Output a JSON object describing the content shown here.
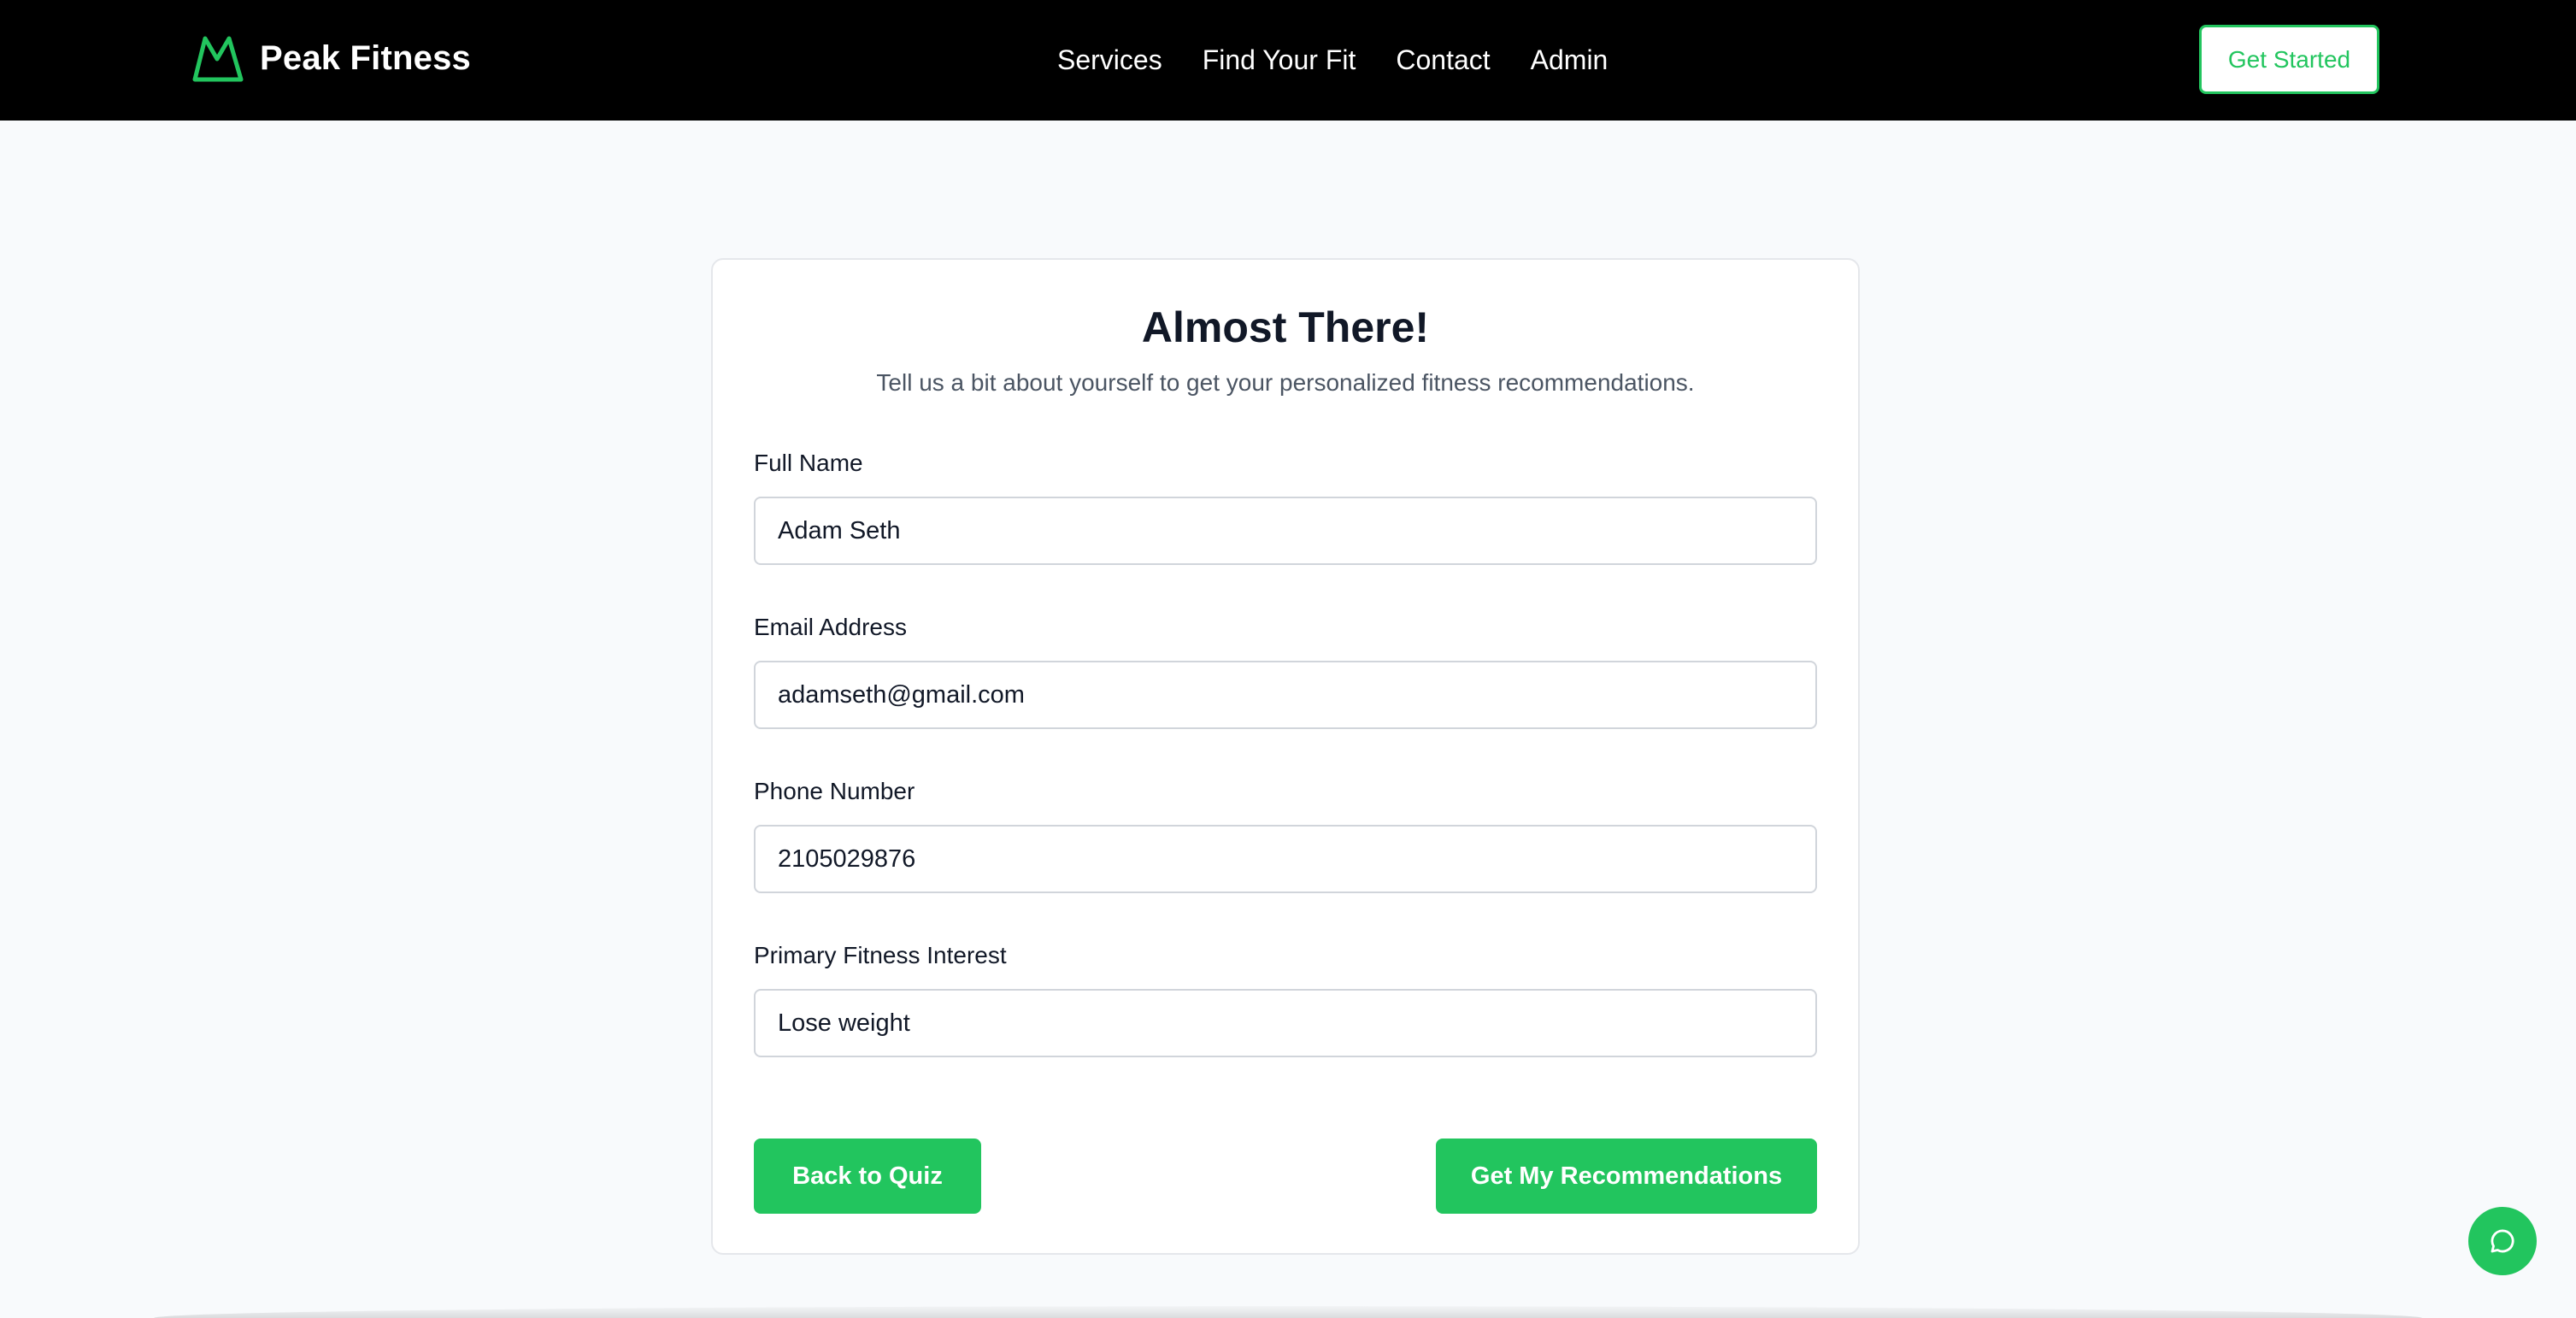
{
  "brand": {
    "name": "Peak Fitness",
    "accent_color": "#22c55e"
  },
  "nav": {
    "links": [
      "Services",
      "Find Your Fit",
      "Contact",
      "Admin"
    ],
    "cta_label": "Get Started"
  },
  "form": {
    "title": "Almost There!",
    "subtitle": "Tell us a bit about yourself to get your personalized fitness recommendations.",
    "fields": [
      {
        "label": "Full Name",
        "value": "Adam Seth"
      },
      {
        "label": "Email Address",
        "value": "adamseth@gmail.com"
      },
      {
        "label": "Phone Number",
        "value": "2105029876"
      },
      {
        "label": "Primary Fitness Interest",
        "value": "Lose weight"
      }
    ],
    "back_label": "Back to Quiz",
    "submit_label": "Get My Recommendations"
  },
  "chat": {
    "icon": "chat-bubble-icon"
  }
}
